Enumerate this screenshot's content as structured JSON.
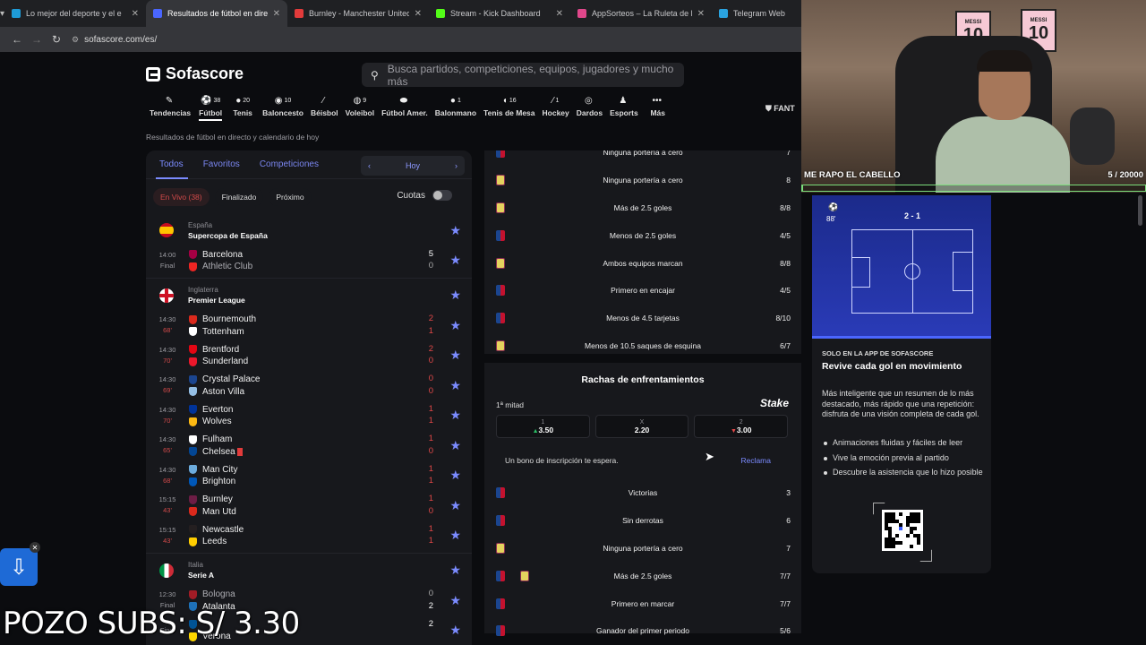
{
  "tabs": [
    {
      "title": "Lo mejor del deporte y el e",
      "fav": "#1e9bd7",
      "active": false
    },
    {
      "title": "Resultados de fútbol en directo",
      "fav": "#4a66ff",
      "active": true
    },
    {
      "title": "Burnley - Manchester United C",
      "fav": "#e23b3b",
      "active": false
    },
    {
      "title": "Stream - Kick Dashboard",
      "fav": "#53fc18",
      "active": false
    },
    {
      "title": "AppSorteos – La Ruleta de la S",
      "fav": "#e0478b",
      "active": false
    },
    {
      "title": "Telegram Web",
      "fav": "#2aa3e0",
      "active": false
    }
  ],
  "url": "sofascore.com/es/",
  "logo": "Sofascore",
  "search_placeholder": "Busca partidos, competiciones, equipos, jugadores y mucho más",
  "sports": [
    {
      "label": "Tendencias",
      "count": "",
      "icon": "fire-icon"
    },
    {
      "label": "Fútbol",
      "count": "38",
      "icon": "football-icon",
      "active": true
    },
    {
      "label": "Tenis",
      "count": "20",
      "icon": "tennis-icon"
    },
    {
      "label": "Baloncesto",
      "count": "10",
      "icon": "basketball-icon"
    },
    {
      "label": "Béisbol",
      "count": "",
      "icon": "baseball-icon"
    },
    {
      "label": "Voleibol",
      "count": "9",
      "icon": "volleyball-icon"
    },
    {
      "label": "Fútbol Amer.",
      "count": "",
      "icon": "american-football-icon"
    },
    {
      "label": "Balonmano",
      "count": "1",
      "icon": "handball-icon"
    },
    {
      "label": "Tenis de Mesa",
      "count": "16",
      "icon": "table-tennis-icon"
    },
    {
      "label": "Hockey",
      "count": "1",
      "icon": "hockey-icon"
    },
    {
      "label": "Dardos",
      "count": "",
      "icon": "darts-icon"
    },
    {
      "label": "Esports",
      "count": "",
      "icon": "esports-icon"
    },
    {
      "label": "Más",
      "count": "",
      "icon": "more-icon"
    }
  ],
  "fantasy_label": "FANT",
  "subtitle": "Resultados de fútbol en directo y calendario de hoy",
  "left_tabs": [
    "Todos",
    "Favoritos",
    "Competiciones"
  ],
  "date_label": "Hoy",
  "filters": {
    "live": "En Vivo (38)",
    "finished": "Finalizado",
    "next": "Próximo",
    "odds": "Cuotas"
  },
  "leagues": [
    {
      "country": "España",
      "name": "Supercopa de España",
      "flag": "es",
      "matches": [
        {
          "time": "14:00",
          "status": "Final",
          "live": false,
          "home": "Barcelona",
          "away": "Athletic Club",
          "hs": "5",
          "as": "0",
          "hc": "#a50044",
          "ac": "#ee2523",
          "awayLose": true
        }
      ]
    },
    {
      "country": "Inglaterra",
      "name": "Premier League",
      "flag": "en",
      "matches": [
        {
          "time": "14:30",
          "status": "68'",
          "live": true,
          "home": "Bournemouth",
          "away": "Tottenham",
          "hs": "2",
          "as": "1",
          "hc": "#da291c",
          "ac": "#ffffff"
        },
        {
          "time": "14:30",
          "status": "70'",
          "live": true,
          "home": "Brentford",
          "away": "Sunderland",
          "hs": "2",
          "as": "0",
          "hc": "#e30613",
          "ac": "#eb172b"
        },
        {
          "time": "14:30",
          "status": "69'",
          "live": true,
          "home": "Crystal Palace",
          "away": "Aston Villa",
          "hs": "0",
          "as": "0",
          "hc": "#1b458f",
          "ac": "#95bfe5"
        },
        {
          "time": "14:30",
          "status": "70'",
          "live": true,
          "home": "Everton",
          "away": "Wolves",
          "hs": "1",
          "as": "1",
          "hc": "#003399",
          "ac": "#fdb913"
        },
        {
          "time": "14:30",
          "status": "65'",
          "live": true,
          "home": "Fulham",
          "away": "Chelsea",
          "hs": "1",
          "as": "0",
          "hc": "#ffffff",
          "ac": "#034694",
          "awayRed": true
        },
        {
          "time": "14:30",
          "status": "68'",
          "live": true,
          "home": "Man City",
          "away": "Brighton",
          "hs": "1",
          "as": "1",
          "hc": "#6cabdd",
          "ac": "#0057b8"
        },
        {
          "time": "15:15",
          "status": "43'",
          "live": true,
          "home": "Burnley",
          "away": "Man Utd",
          "hs": "1",
          "as": "0",
          "hc": "#6c1d45",
          "ac": "#da291c"
        },
        {
          "time": "15:15",
          "status": "43'",
          "live": true,
          "home": "Newcastle",
          "away": "Leeds",
          "hs": "1",
          "as": "1",
          "hc": "#241f20",
          "ac": "#ffcd00"
        }
      ]
    },
    {
      "country": "Italia",
      "name": "Serie A",
      "flag": "it",
      "matches": [
        {
          "time": "12:30",
          "status": "Final",
          "live": false,
          "home": "Bologna",
          "away": "Atalanta",
          "hs": "0",
          "as": "2",
          "hc": "#a21c26",
          "ac": "#1e71b8",
          "homeLose": true
        },
        {
          "time": "",
          "status": "Final",
          "live": false,
          "home": "",
          "away": "Verona",
          "hs": "2",
          "as": "",
          "hc": "#005395",
          "ac": "#ffd700"
        }
      ]
    }
  ],
  "team_streaks": [
    {
      "kit": "cp",
      "label": "Ninguna portería a cero",
      "value": "7"
    },
    {
      "kit": "av",
      "label": "Ninguna portería a cero",
      "value": "8"
    },
    {
      "kit": "av",
      "label": "Más de 2.5 goles",
      "value": "8/8"
    },
    {
      "kit": "cp",
      "label": "Menos de 2.5 goles",
      "value": "4/5"
    },
    {
      "kit": "av",
      "label": "Ambos equipos marcan",
      "value": "8/8"
    },
    {
      "kit": "cp",
      "label": "Primero en encajar",
      "value": "4/5"
    },
    {
      "kit": "cp",
      "label": "Menos de 4.5 tarjetas",
      "value": "8/10"
    },
    {
      "kit": "av",
      "label": "Menos de 10.5 saques de esquina",
      "value": "6/7"
    }
  ],
  "h2h": {
    "title": "Rachas de enfrentamientos",
    "half": "1ª mitad",
    "brand": "Stake",
    "odds": [
      {
        "key": "1",
        "value": "3.50",
        "trend": "up"
      },
      {
        "key": "X",
        "value": "2.20",
        "trend": ""
      },
      {
        "key": "2",
        "value": "3.00",
        "trend": "down"
      }
    ],
    "bonus": "Un bono de inscripción te espera.",
    "claim": "Reclama",
    "rows": [
      {
        "kits": [
          "cp"
        ],
        "label": "Victorias",
        "value": "3"
      },
      {
        "kits": [
          "cp"
        ],
        "label": "Sin derrotas",
        "value": "6"
      },
      {
        "kits": [
          "av"
        ],
        "label": "Ninguna portería a cero",
        "value": "7"
      },
      {
        "kits": [
          "cp",
          "av"
        ],
        "label": "Más de 2.5 goles",
        "value": "7/7"
      },
      {
        "kits": [
          "cp"
        ],
        "label": "Primero en marcar",
        "value": "7/7"
      },
      {
        "kits": [
          "cp"
        ],
        "label": "Ganador del primer periodo",
        "value": "5/6"
      }
    ]
  },
  "stream": {
    "overlay_text": "ME RAPO EL CABELLO",
    "sub_count": "5 / 20000",
    "progress": 0.00025,
    "pozo": "POZO SUBS: S/ 3.30",
    "poster_name": "MESSI",
    "poster_number": "10"
  },
  "promo": {
    "mini_score": "2 - 1",
    "mini_minute": "88'",
    "tag": "SOLO EN LA APP DE SOFASCORE",
    "headline": "Revive cada gol en movimiento",
    "description": "Más inteligente que un resumen de lo más destacado, más rápido que una repetición: disfruta de una visión completa de cada gol.",
    "bullets": [
      "Animaciones fluidas y fáciles de leer",
      "Vive la emoción previa al partido",
      "Descubre la asistencia que lo hizo posible"
    ]
  }
}
